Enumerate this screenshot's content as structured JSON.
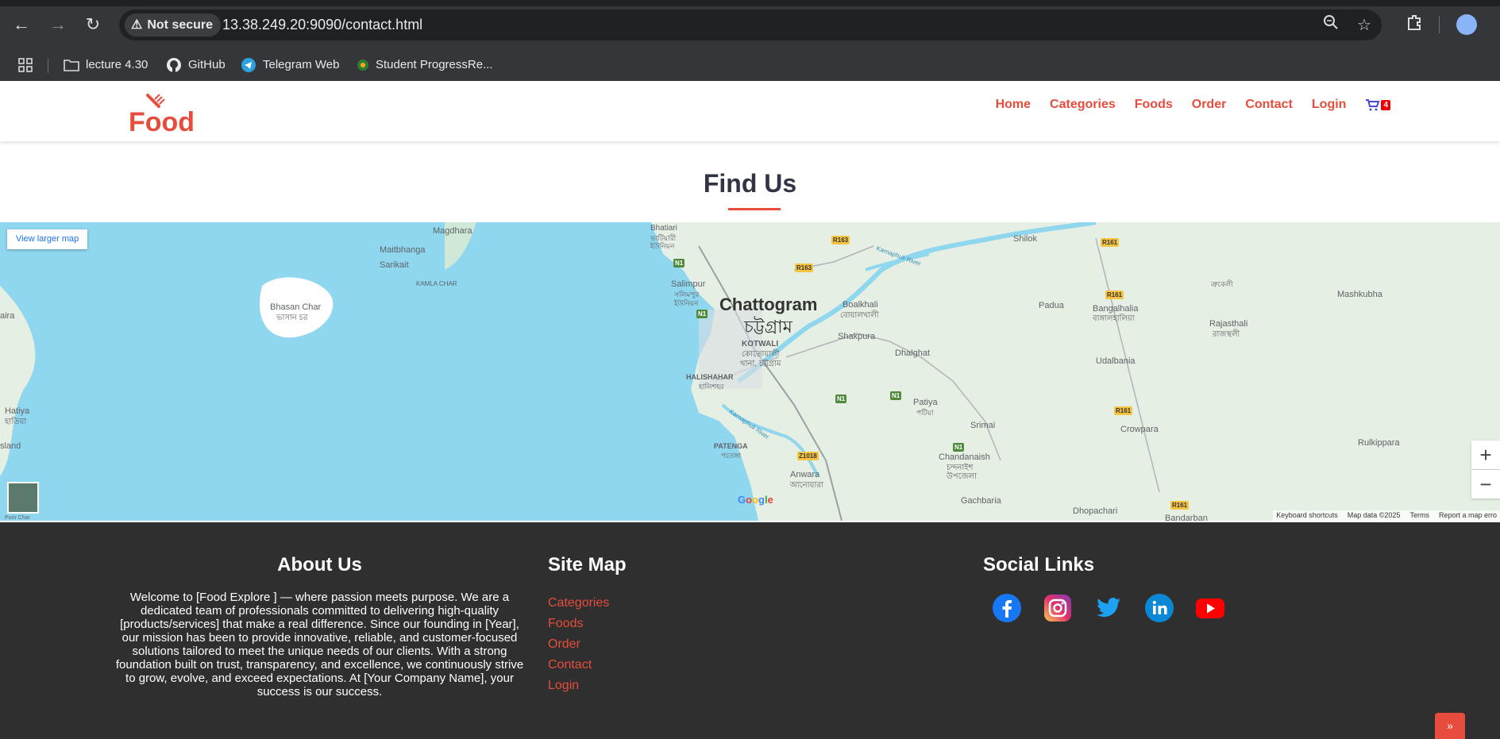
{
  "browser": {
    "security_label": "Not secure",
    "url": "13.38.249.20:9090/contact.html",
    "bookmarks": [
      {
        "label": "lecture 4.30",
        "icon": "folder-icon"
      },
      {
        "label": "GitHub",
        "icon": "github-icon"
      },
      {
        "label": "Telegram Web",
        "icon": "telegram-icon"
      },
      {
        "label": "Student ProgressRe...",
        "icon": "student-progress-icon"
      }
    ]
  },
  "header": {
    "logo_text": "Food",
    "nav": [
      "Home",
      "Categories",
      "Foods",
      "Order",
      "Contact",
      "Login"
    ],
    "cart_count": "4",
    "accent_color": "#e74c3c"
  },
  "find_us": {
    "title": "Find Us"
  },
  "map": {
    "larger_map_label": "View larger map",
    "city_en": "Chattogram",
    "city_bn": "চট্টগ্রাম",
    "places": {
      "magdhara": "Magdhara",
      "maitbhanga": "Maitbhanga",
      "sarikait": "Sarikait",
      "kamla_char": "KAMLA CHAR",
      "bhasan_char": "Bhasan Char",
      "bhasan_char_bn": "ভাসান চর",
      "hatiya": "Hatiya",
      "hatiya_bn": "হাতিয়া",
      "island": "sland",
      "aira": "aira",
      "bhatiari": "Bhatiari",
      "bhatiari_bn": "ভাটিয়ারী",
      "union_bn": "ইউনিয়ন",
      "salimpur": "Salimpur",
      "salimpur_bn": "সলিমপুর",
      "kotwali": "KOTWALI",
      "kotwali_bn": "কোতোয়ালী",
      "kotwali_bn2": "থানা, চট্টগ্রাম",
      "halishahar": "HALISHAHAR",
      "halishahar_bn": "হালিশহর",
      "patenga": "PATENGA",
      "patenga_bn": "পতেঙ্গা",
      "anwara": "Anwara",
      "anwara_bn": "আনোয়ারা",
      "boalkhali": "Boalkhali",
      "boalkhali_bn": "বোয়ালখালী",
      "shakpura": "Shakpura",
      "dhalghat": "Dhalghat",
      "patiya": "Patiya",
      "patiya_bn": "পটিয়া",
      "srimai": "Srimai",
      "chandanaish": "Chandanaish",
      "chandanaish_bn": "চন্দনাইশ",
      "chandanaish_bn2": "উপজেলা",
      "gachbaria": "Gachbaria",
      "shilok": "Shilok",
      "padua": "Padua",
      "bangalhalia": "Bangalhalia",
      "bangalhalia_bn": "বাঙ্গালহালিয়া",
      "udalbania": "Udalbania",
      "crowpara": "Crowpara",
      "rajasthali": "Rajasthali",
      "rajasthali_bn": "রাজস্থলী",
      "mashkubha": "Mashkubha",
      "rulkippara": "Rulkippara",
      "dhopachari": "Dhopachari",
      "bandarban": "Bandarban",
      "karnaphuli": "Karnaphuli River",
      "upper_bn": "ত্রুকেলী"
    },
    "roads": [
      "R163",
      "R163",
      "R161",
      "R161",
      "R161",
      "R161",
      "Z1018"
    ],
    "national_roads": [
      "N1",
      "N1",
      "N1",
      "N1",
      "N1"
    ],
    "google_letters": [
      "G",
      "o",
      "o",
      "g",
      "l",
      "e"
    ],
    "google_colors": [
      "#4285f4",
      "#ea4335",
      "#fbbc05",
      "#4285f4",
      "#34a853",
      "#ea4335"
    ],
    "attribution": [
      "Keyboard shortcuts",
      "Map data ©2025",
      "Terms",
      "Report a map erro"
    ],
    "zoom_in": "+",
    "zoom_out": "−",
    "sat_label": "Purir Char",
    "colors": {
      "water": "#8fd6ef",
      "land": "#e6efe3",
      "green": "#cfe9d6"
    }
  },
  "footer": {
    "about_title": "About Us",
    "about_text": "Welcome to [Food Explore ] — where passion meets purpose. We are a dedicated team of professionals committed to delivering high-quality [products/services] that make a real difference. Since our founding in [Year], our mission has been to provide innovative, reliable, and customer-focused solutions tailored to meet the unique needs of our clients. With a strong foundation built on trust, transparency, and excellence, we continuously strive to grow, evolve, and exceed expectations. At [Your Company Name], your success is our success.",
    "sitemap_title": "Site Map",
    "sitemap_links": [
      "Categories",
      "Foods",
      "Order",
      "Contact",
      "Login"
    ],
    "social_title": "Social Links",
    "social_icons": [
      "facebook-icon",
      "instagram-icon",
      "twitter-icon",
      "linkedin-icon",
      "youtube-icon"
    ],
    "back_to_top": "»"
  }
}
